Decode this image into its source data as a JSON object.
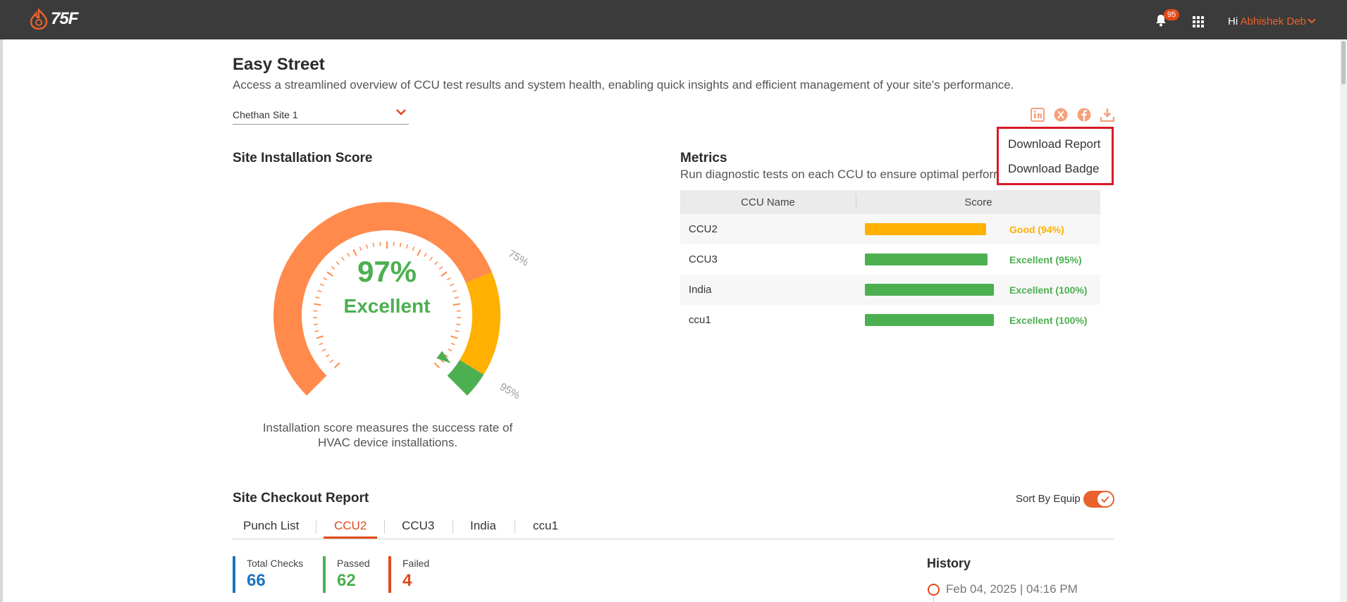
{
  "header": {
    "logo_text": "75F",
    "notification_count": "95",
    "greeting": "Hi",
    "user_name": "Abhishek Deb"
  },
  "page": {
    "title": "Easy Street",
    "subtitle": "Access a streamlined overview of CCU test results and system health, enabling quick insights and efficient management of your site's performance.",
    "site_selector_value": "Chethan Site 1"
  },
  "share_icons": [
    "linkedin-icon",
    "x-icon",
    "facebook-icon",
    "download-icon"
  ],
  "download_menu": {
    "items": [
      "Download Report",
      "Download Badge"
    ]
  },
  "installation": {
    "title": "Site Installation Score",
    "score": "97%",
    "rating": "Excellent",
    "score_fraction": 0.97,
    "threshold_labels": [
      "75%",
      "95%"
    ],
    "description": "Installation score measures the success rate of HVAC device installations.",
    "colors": {
      "low": "#ff8a4c",
      "mid": "#ffb000",
      "high": "#4caf50"
    }
  },
  "metrics": {
    "title": "Metrics",
    "subtitle": "Run diagnostic tests on each CCU to ensure optimal perforr",
    "columns": [
      "CCU Name",
      "Score"
    ],
    "rows": [
      {
        "name": "CCU2",
        "score": 94,
        "label": "Good (94%)",
        "color": "#ffb000"
      },
      {
        "name": "CCU3",
        "score": 95,
        "label": "Excellent (95%)",
        "color": "#4caf50"
      },
      {
        "name": "India",
        "score": 100,
        "label": "Excellent (100%)",
        "color": "#4caf50"
      },
      {
        "name": "ccu1",
        "score": 100,
        "label": "Excellent (100%)",
        "color": "#4caf50"
      }
    ]
  },
  "checkout": {
    "title": "Site Checkout Report",
    "sort_label": "Sort By Equip",
    "sort_enabled": true,
    "tabs": [
      "Punch List",
      "CCU2",
      "CCU3",
      "India",
      "ccu1"
    ],
    "active_tab": "CCU2",
    "stats": [
      {
        "label": "Total Checks",
        "value": "66",
        "color": "#1e73be"
      },
      {
        "label": "Passed",
        "value": "62",
        "color": "#4caf50"
      },
      {
        "label": "Failed",
        "value": "4",
        "color": "#e24a1a"
      }
    ],
    "history_title": "History",
    "history_entries": [
      "Feb 04, 2025 | 04:16 PM"
    ]
  }
}
